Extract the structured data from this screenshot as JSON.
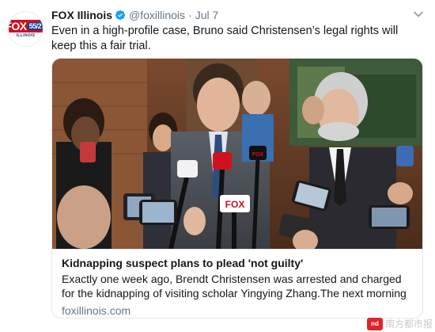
{
  "account": {
    "display_name": "FOX Illinois",
    "handle": "@foxillinois",
    "separator": "·",
    "time": "Jul 7",
    "avatar": {
      "brand": "FOX",
      "channel": "55/27",
      "subtitle": "ILLINOIS"
    }
  },
  "tweet": {
    "text": "Even in a high-profile case, Bruno said Christensen’s legal rights will keep this a fair trial."
  },
  "card": {
    "title": "Kidnapping suspect plans to plead 'not guilty'",
    "description": "Exactly one week ago, Brendt Christensen was arrested and charged for the kidnapping of visiting scholar Yingying Zhang.The next morning the susp...",
    "domain": "foxillinois.com",
    "image_mic_logos": [
      "FOX",
      "FOX"
    ]
  },
  "watermark": {
    "logo": "nd",
    "text": "南方都市报"
  },
  "colors": {
    "verified": "#1da1f2",
    "muted": "#657786",
    "fox_red": "#d0121f",
    "border": "#e1e8ed"
  },
  "icons": [
    "verified-icon",
    "chevron-down-icon"
  ]
}
